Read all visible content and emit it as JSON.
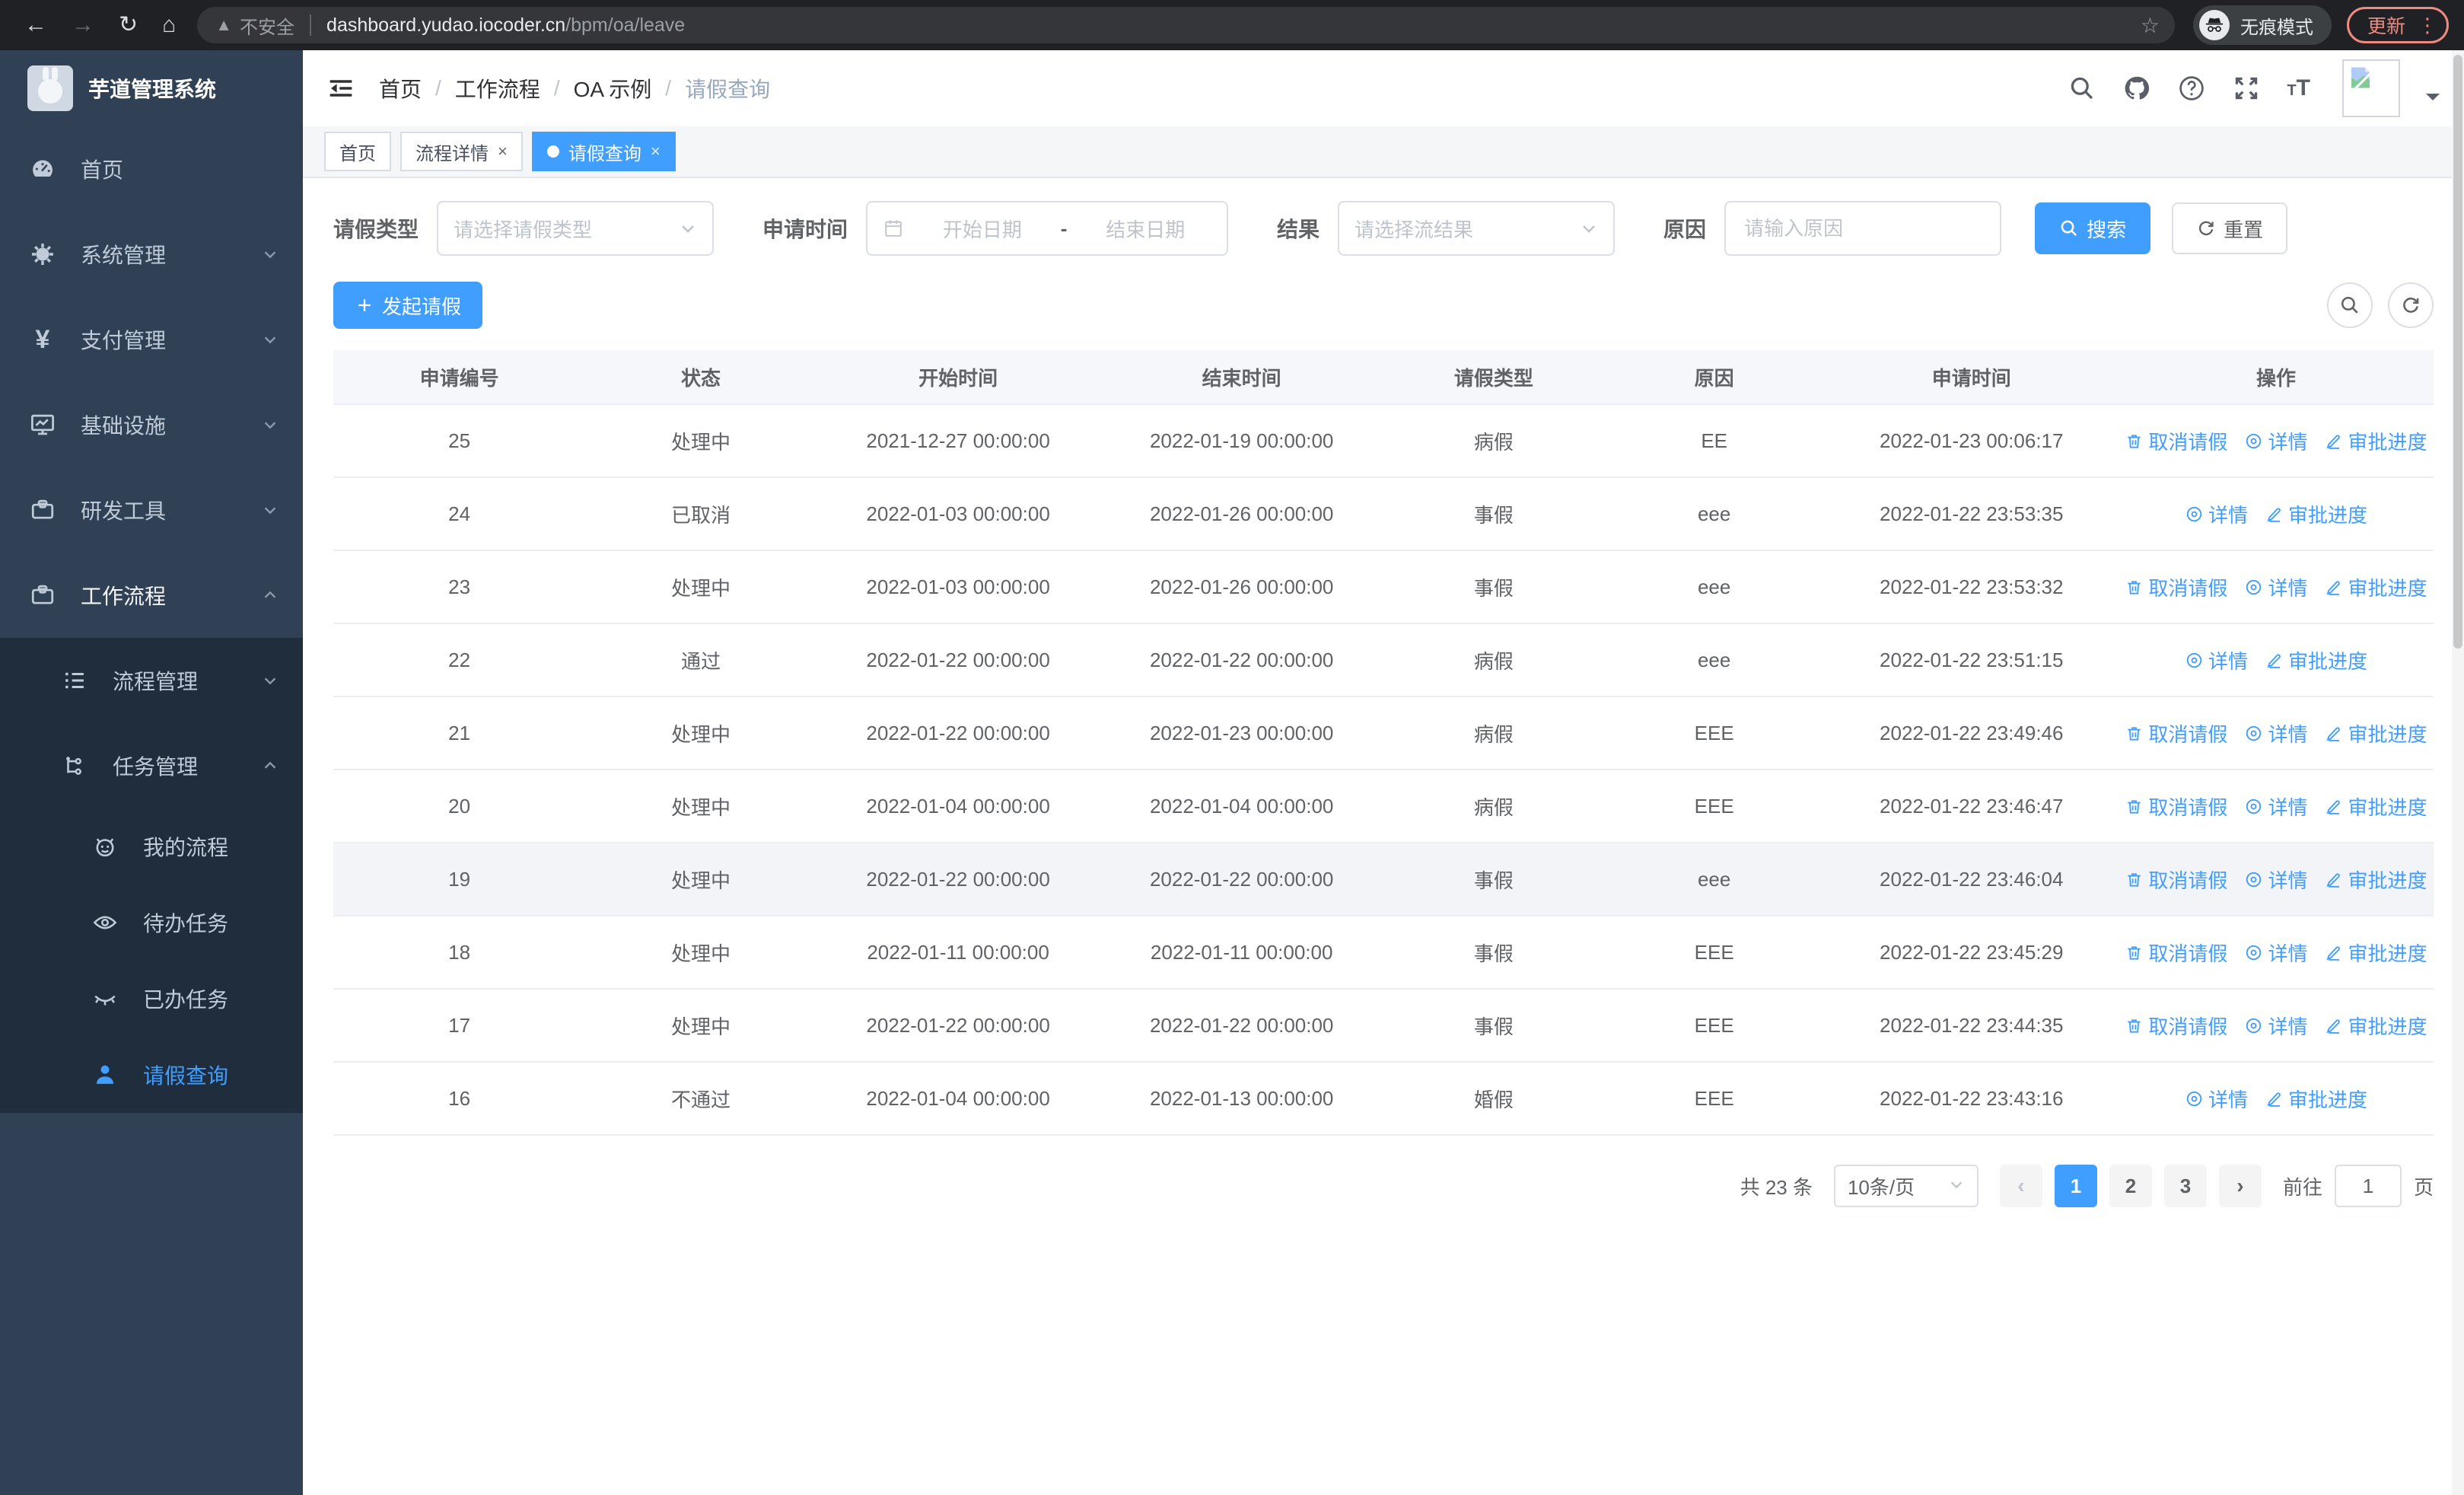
{
  "browser": {
    "security_label": "不安全",
    "url_host": "dashboard.yudao.iocoder.cn",
    "url_path": "/bpm/oa/leave",
    "incognito_label": "无痕模式",
    "update_label": "更新"
  },
  "sidebar": {
    "app_title": "芋道管理系统",
    "items": [
      {
        "key": "home",
        "label": "首页",
        "icon": "dashboard-icon",
        "level": 1,
        "caret": null,
        "active": false,
        "bright": false
      },
      {
        "key": "system-mgmt",
        "label": "系统管理",
        "icon": "gear-icon",
        "level": 1,
        "caret": "down",
        "active": false,
        "bright": false
      },
      {
        "key": "payment-mgmt",
        "label": "支付管理",
        "icon": "yen-icon",
        "level": 1,
        "caret": "down",
        "active": false,
        "bright": false
      },
      {
        "key": "infrastructure",
        "label": "基础设施",
        "icon": "monitor-icon",
        "level": 1,
        "caret": "down",
        "active": false,
        "bright": false
      },
      {
        "key": "dev-tools",
        "label": "研发工具",
        "icon": "toolbox-icon",
        "level": 1,
        "caret": "down",
        "active": false,
        "bright": false
      },
      {
        "key": "workflow",
        "label": "工作流程",
        "icon": "briefcase-icon",
        "level": 1,
        "caret": "up",
        "active": false,
        "bright": true
      },
      {
        "key": "process-mgmt",
        "label": "流程管理",
        "icon": "list-icon",
        "level": 2,
        "caret": "down",
        "active": false,
        "bright": false
      },
      {
        "key": "task-mgmt",
        "label": "任务管理",
        "icon": "flow-icon",
        "level": 2,
        "caret": "up",
        "active": false,
        "bright": false
      },
      {
        "key": "my-process",
        "label": "我的流程",
        "icon": "face-icon",
        "level": 3,
        "caret": null,
        "active": false,
        "bright": false
      },
      {
        "key": "todo-tasks",
        "label": "待办任务",
        "icon": "eye-icon",
        "level": 3,
        "caret": null,
        "active": false,
        "bright": false
      },
      {
        "key": "done-tasks",
        "label": "已办任务",
        "icon": "eye-closed-icon",
        "level": 3,
        "caret": null,
        "active": false,
        "bright": false
      },
      {
        "key": "leave-query",
        "label": "请假查询",
        "icon": "user-icon",
        "level": 3,
        "caret": null,
        "active": true,
        "bright": false
      }
    ]
  },
  "breadcrumb": [
    "首页",
    "工作流程",
    "OA 示例",
    "请假查询"
  ],
  "tabs": [
    {
      "label": "首页",
      "closable": false,
      "active": false
    },
    {
      "label": "流程详情",
      "closable": true,
      "active": false
    },
    {
      "label": "请假查询",
      "closable": true,
      "active": true
    }
  ],
  "filters": {
    "leave_type_label": "请假类型",
    "leave_type_placeholder": "请选择请假类型",
    "apply_time_label": "申请时间",
    "start_date_placeholder": "开始日期",
    "range_separator": "-",
    "end_date_placeholder": "结束日期",
    "result_label": "结果",
    "result_placeholder": "请选择流结果",
    "reason_label": "原因",
    "reason_placeholder": "请输入原因",
    "search_button": "搜索",
    "reset_button": "重置"
  },
  "toolbar": {
    "create_button": "发起请假"
  },
  "table": {
    "columns": [
      "申请编号",
      "状态",
      "开始时间",
      "结束时间",
      "请假类型",
      "原因",
      "申请时间",
      "操作"
    ],
    "action_labels": {
      "cancel": "取消请假",
      "detail": "详情",
      "progress": "审批进度"
    },
    "rows": [
      {
        "id": "25",
        "status": "处理中",
        "start": "2021-12-27 00:00:00",
        "end": "2022-01-19 00:00:00",
        "type": "病假",
        "reason": "EE",
        "apply_time": "2022-01-23 00:06:17",
        "actions": [
          "cancel",
          "detail",
          "progress"
        ],
        "highlight": false
      },
      {
        "id": "24",
        "status": "已取消",
        "start": "2022-01-03 00:00:00",
        "end": "2022-01-26 00:00:00",
        "type": "事假",
        "reason": "eee",
        "apply_time": "2022-01-22 23:53:35",
        "actions": [
          "detail",
          "progress"
        ],
        "highlight": false
      },
      {
        "id": "23",
        "status": "处理中",
        "start": "2022-01-03 00:00:00",
        "end": "2022-01-26 00:00:00",
        "type": "事假",
        "reason": "eee",
        "apply_time": "2022-01-22 23:53:32",
        "actions": [
          "cancel",
          "detail",
          "progress"
        ],
        "highlight": false
      },
      {
        "id": "22",
        "status": "通过",
        "start": "2022-01-22 00:00:00",
        "end": "2022-01-22 00:00:00",
        "type": "病假",
        "reason": "eee",
        "apply_time": "2022-01-22 23:51:15",
        "actions": [
          "detail",
          "progress"
        ],
        "highlight": false
      },
      {
        "id": "21",
        "status": "处理中",
        "start": "2022-01-22 00:00:00",
        "end": "2022-01-23 00:00:00",
        "type": "病假",
        "reason": "EEE",
        "apply_time": "2022-01-22 23:49:46",
        "actions": [
          "cancel",
          "detail",
          "progress"
        ],
        "highlight": false
      },
      {
        "id": "20",
        "status": "处理中",
        "start": "2022-01-04 00:00:00",
        "end": "2022-01-04 00:00:00",
        "type": "病假",
        "reason": "EEE",
        "apply_time": "2022-01-22 23:46:47",
        "actions": [
          "cancel",
          "detail",
          "progress"
        ],
        "highlight": false
      },
      {
        "id": "19",
        "status": "处理中",
        "start": "2022-01-22 00:00:00",
        "end": "2022-01-22 00:00:00",
        "type": "事假",
        "reason": "eee",
        "apply_time": "2022-01-22 23:46:04",
        "actions": [
          "cancel",
          "detail",
          "progress"
        ],
        "highlight": true
      },
      {
        "id": "18",
        "status": "处理中",
        "start": "2022-01-11 00:00:00",
        "end": "2022-01-11 00:00:00",
        "type": "事假",
        "reason": "EEE",
        "apply_time": "2022-01-22 23:45:29",
        "actions": [
          "cancel",
          "detail",
          "progress"
        ],
        "highlight": false
      },
      {
        "id": "17",
        "status": "处理中",
        "start": "2022-01-22 00:00:00",
        "end": "2022-01-22 00:00:00",
        "type": "事假",
        "reason": "EEE",
        "apply_time": "2022-01-22 23:44:35",
        "actions": [
          "cancel",
          "detail",
          "progress"
        ],
        "highlight": false
      },
      {
        "id": "16",
        "status": "不通过",
        "start": "2022-01-04 00:00:00",
        "end": "2022-01-13 00:00:00",
        "type": "婚假",
        "reason": "EEE",
        "apply_time": "2022-01-22 23:43:16",
        "actions": [
          "detail",
          "progress"
        ],
        "highlight": false
      }
    ]
  },
  "pagination": {
    "total_text": "共 23 条",
    "page_size": "10条/页",
    "pages": [
      "1",
      "2",
      "3"
    ],
    "active_page": "1",
    "prev_symbol": "‹",
    "next_symbol": "›",
    "goto_label": "前往",
    "goto_value": "1",
    "goto_suffix": "页"
  },
  "colors": {
    "accent": "#409eff",
    "sidebar": "#304156",
    "submenu": "#1f2d3d",
    "update_pill": "#ef8a80"
  }
}
